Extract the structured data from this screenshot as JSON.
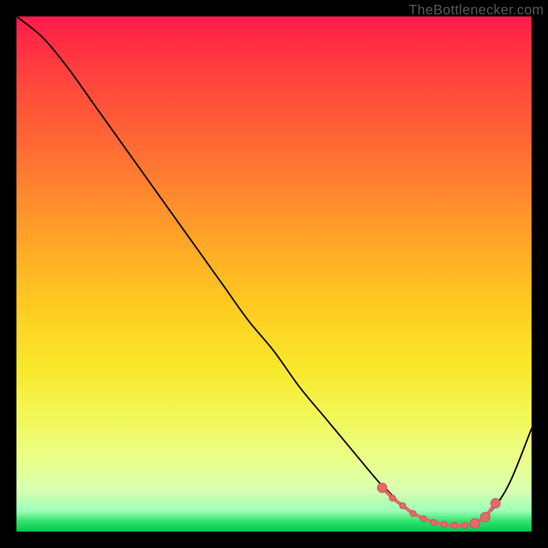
{
  "attribution": "TheBottlenecker.com",
  "colors": {
    "background": "#000000",
    "gradient_top": "#ff1b4a",
    "gradient_bottom": "#00c853",
    "curve": "#000000",
    "marker": "#e36a6a"
  },
  "chart_data": {
    "type": "line",
    "title": "",
    "xlabel": "",
    "ylabel": "",
    "xlim": [
      0,
      100
    ],
    "ylim": [
      0,
      100
    ],
    "series": [
      {
        "name": "bottleneck-curve",
        "x": [
          0,
          5,
          10,
          15,
          20,
          25,
          30,
          35,
          40,
          45,
          50,
          55,
          60,
          65,
          70,
          72,
          75,
          78,
          80,
          82,
          85,
          88,
          90,
          93,
          96,
          100
        ],
        "y": [
          100,
          96,
          90,
          83,
          76,
          69,
          62,
          55,
          48,
          41,
          35,
          28,
          22,
          16,
          10,
          8,
          5,
          3,
          2,
          1.5,
          1.2,
          1.2,
          2,
          5,
          10,
          20
        ]
      }
    ],
    "markers": {
      "name": "highlighted-range",
      "x": [
        71,
        73,
        75,
        77,
        79,
        81,
        83,
        85,
        87,
        89,
        91,
        93
      ],
      "y": [
        8.5,
        6.5,
        5.0,
        3.5,
        2.5,
        1.8,
        1.4,
        1.2,
        1.2,
        1.6,
        2.8,
        5.5
      ]
    }
  }
}
